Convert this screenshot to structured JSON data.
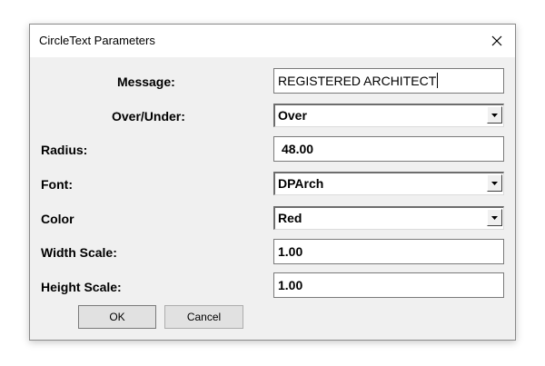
{
  "dialog": {
    "title": "CircleText Parameters",
    "close_symbol": "close-icon"
  },
  "form": {
    "message": {
      "label": "Message:",
      "value": "REGISTERED ARCHITECT"
    },
    "over_under": {
      "label": "Over/Under:",
      "value": "Over"
    },
    "radius": {
      "label": "Radius:",
      "value": "48.00"
    },
    "font": {
      "label": "Font:",
      "value": "DPArch"
    },
    "color": {
      "label": "Color",
      "value": "Red"
    },
    "width_scale": {
      "label": "Width Scale:",
      "value": "1.00"
    },
    "height_scale": {
      "label": "Height Scale:",
      "value": "1.00"
    }
  },
  "buttons": {
    "ok_label": "OK",
    "cancel_label": "Cancel"
  },
  "colors": {
    "dialog_bg": "#f0f0f0",
    "titlebar_bg": "#ffffff",
    "field_bg": "#ffffff",
    "button_bg": "#e1e1e1"
  }
}
